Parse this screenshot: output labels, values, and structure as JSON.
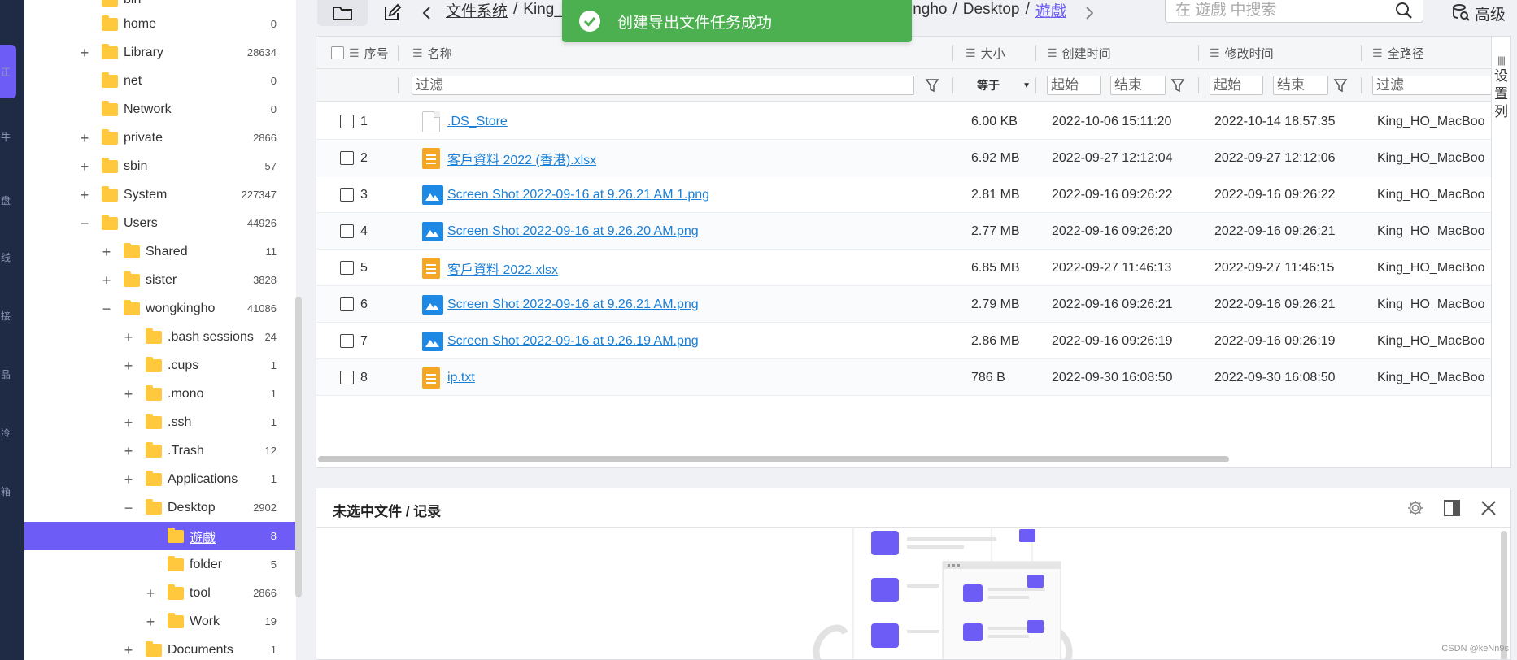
{
  "rail": {
    "accent": "#6d5cf6",
    "glyphs": [
      "正",
      "牛",
      "盘",
      "线",
      "接",
      "品",
      "冷",
      "箱"
    ]
  },
  "tree": {
    "top_item": {
      "name": "bin",
      "count": ""
    },
    "items": [
      {
        "name": "home",
        "count": "0",
        "toggle": ""
      },
      {
        "name": "Library",
        "count": "28634",
        "toggle": "+"
      },
      {
        "name": "net",
        "count": "0",
        "toggle": ""
      },
      {
        "name": "Network",
        "count": "0",
        "toggle": ""
      },
      {
        "name": "private",
        "count": "2866",
        "toggle": "+"
      },
      {
        "name": "sbin",
        "count": "57",
        "toggle": "+"
      },
      {
        "name": "System",
        "count": "227347",
        "toggle": "+"
      },
      {
        "name": "Users",
        "count": "44926",
        "toggle": "−"
      },
      {
        "name": "Shared",
        "count": "11",
        "toggle": "+"
      },
      {
        "name": "sister",
        "count": "3828",
        "toggle": "+"
      },
      {
        "name": "wongkingho",
        "count": "41086",
        "toggle": "−"
      },
      {
        "name": ".bash sessions",
        "count": "24",
        "toggle": "+"
      },
      {
        "name": ".cups",
        "count": "1",
        "toggle": "+"
      },
      {
        "name": ".mono",
        "count": "1",
        "toggle": "+"
      },
      {
        "name": ".ssh",
        "count": "1",
        "toggle": "+"
      },
      {
        "name": ".Trash",
        "count": "12",
        "toggle": "+"
      },
      {
        "name": "Applications",
        "count": "1",
        "toggle": "+"
      },
      {
        "name": "Desktop",
        "count": "2902",
        "toggle": "−"
      },
      {
        "name": "遊戲",
        "count": "8",
        "toggle": ""
      },
      {
        "name": "folder",
        "count": "5",
        "toggle": ""
      },
      {
        "name": "tool",
        "count": "2866",
        "toggle": "+"
      },
      {
        "name": "Work",
        "count": "19",
        "toggle": "+"
      },
      {
        "name": "Documents",
        "count": "1",
        "toggle": "+"
      }
    ]
  },
  "toolbar": {
    "breadcrumb_left": [
      "文件系统",
      "King_H"
    ],
    "breadcrumb_right": [
      "ingho",
      "Desktop",
      "遊戲"
    ],
    "search_placeholder": "在 遊戲 中搜索",
    "advanced_label": "高级"
  },
  "toast": {
    "message": "创建导出文件任务成功",
    "color": "#4caf50"
  },
  "table": {
    "columns": {
      "index": "序号",
      "name": "名称",
      "size": "大小",
      "created": "创建时间",
      "modified": "修改时间",
      "path": "全路径"
    },
    "filters": {
      "name_placeholder": "过滤",
      "size_operator": "等于",
      "created_start": "起始",
      "created_end": "结束",
      "modified_start": "起始",
      "modified_end": "结束",
      "path_placeholder": "过滤"
    },
    "settings_label": [
      "设",
      "置",
      "列"
    ],
    "rows": [
      {
        "index": "1",
        "name": ".DS_Store",
        "type": "doc",
        "size": "6.00 KB",
        "created": "2022-10-06 15:11:20",
        "modified": "2022-10-14 18:57:35",
        "path": "King_HO_MacBoo"
      },
      {
        "index": "2",
        "name": "客戶資料 2022 (香港).xlsx",
        "type": "sheet",
        "size": "6.92 MB",
        "created": "2022-09-27 12:12:04",
        "modified": "2022-09-27 12:12:06",
        "path": "King_HO_MacBoo"
      },
      {
        "index": "3",
        "name": "Screen Shot 2022-09-16 at 9.26.21 AM 1.png",
        "type": "image",
        "size": "2.81 MB",
        "created": "2022-09-16 09:26:22",
        "modified": "2022-09-16 09:26:22",
        "path": "King_HO_MacBoo"
      },
      {
        "index": "4",
        "name": "Screen Shot 2022-09-16 at 9.26.20 AM.png",
        "type": "image",
        "size": "2.77 MB",
        "created": "2022-09-16 09:26:20",
        "modified": "2022-09-16 09:26:21",
        "path": "King_HO_MacBoo"
      },
      {
        "index": "5",
        "name": "客戶資料 2022.xlsx",
        "type": "sheet",
        "size": "6.85 MB",
        "created": "2022-09-27 11:46:13",
        "modified": "2022-09-27 11:46:15",
        "path": "King_HO_MacBoo"
      },
      {
        "index": "6",
        "name": "Screen Shot 2022-09-16 at 9.26.21 AM.png",
        "type": "image",
        "size": "2.79 MB",
        "created": "2022-09-16 09:26:21",
        "modified": "2022-09-16 09:26:21",
        "path": "King_HO_MacBoo"
      },
      {
        "index": "7",
        "name": "Screen Shot 2022-09-16 at 9.26.19 AM.png",
        "type": "image",
        "size": "2.86 MB",
        "created": "2022-09-16 09:26:19",
        "modified": "2022-09-16 09:26:19",
        "path": "King_HO_MacBoo"
      },
      {
        "index": "8",
        "name": "ip.txt",
        "type": "sheet",
        "size": "786 B",
        "created": "2022-09-30 16:08:50",
        "modified": "2022-09-30 16:08:50",
        "path": "King_HO_MacBoo"
      }
    ]
  },
  "detail": {
    "title": "未选中文件 / 记录"
  },
  "watermark": "CSDN @keNn9s"
}
